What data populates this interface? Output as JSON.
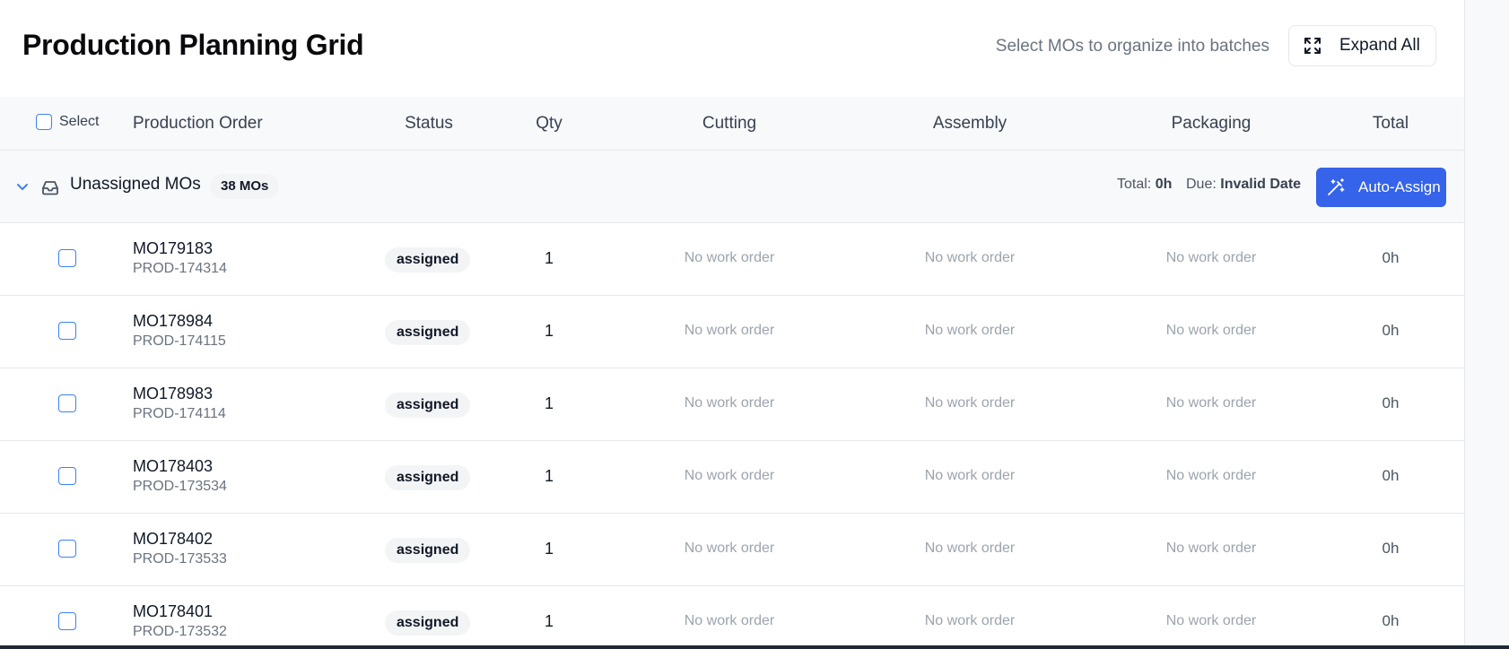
{
  "header": {
    "title": "Production Planning Grid",
    "hint": "Select MOs to organize into batches",
    "expand_label": "Expand All"
  },
  "columns": {
    "select": "Select",
    "production_order": "Production Order",
    "status": "Status",
    "qty": "Qty",
    "cutting": "Cutting",
    "assembly": "Assembly",
    "packaging": "Packaging",
    "total": "Total"
  },
  "group": {
    "label": "Unassigned MOs",
    "badge": "38 MOs",
    "total_label": "Total:",
    "total_value": "0h",
    "due_label": "Due:",
    "due_value": "Invalid Date",
    "auto_assign_label": "Auto-Assign"
  },
  "rows": [
    {
      "mo": "MO179183",
      "prod": "PROD-174314",
      "status": "assigned",
      "qty": "1",
      "cutting": "No work order",
      "assembly": "No work order",
      "packaging": "No work order",
      "total": "0h"
    },
    {
      "mo": "MO178984",
      "prod": "PROD-174115",
      "status": "assigned",
      "qty": "1",
      "cutting": "No work order",
      "assembly": "No work order",
      "packaging": "No work order",
      "total": "0h"
    },
    {
      "mo": "MO178983",
      "prod": "PROD-174114",
      "status": "assigned",
      "qty": "1",
      "cutting": "No work order",
      "assembly": "No work order",
      "packaging": "No work order",
      "total": "0h"
    },
    {
      "mo": "MO178403",
      "prod": "PROD-173534",
      "status": "assigned",
      "qty": "1",
      "cutting": "No work order",
      "assembly": "No work order",
      "packaging": "No work order",
      "total": "0h"
    },
    {
      "mo": "MO178402",
      "prod": "PROD-173533",
      "status": "assigned",
      "qty": "1",
      "cutting": "No work order",
      "assembly": "No work order",
      "packaging": "No work order",
      "total": "0h"
    },
    {
      "mo": "MO178401",
      "prod": "PROD-173532",
      "status": "assigned",
      "qty": "1",
      "cutting": "No work order",
      "assembly": "No work order",
      "packaging": "No work order",
      "total": "0h"
    }
  ],
  "icons": {
    "expand": "maximize-icon",
    "chevron": "chevron-down-icon",
    "inbox": "inbox-icon",
    "auto_assign": "magic-wand-icon"
  },
  "colors": {
    "accent": "#3563e9",
    "checkbox_border": "#3b82f6",
    "header_bg": "#f8f9fb",
    "badge_bg": "#f3f4f6"
  }
}
